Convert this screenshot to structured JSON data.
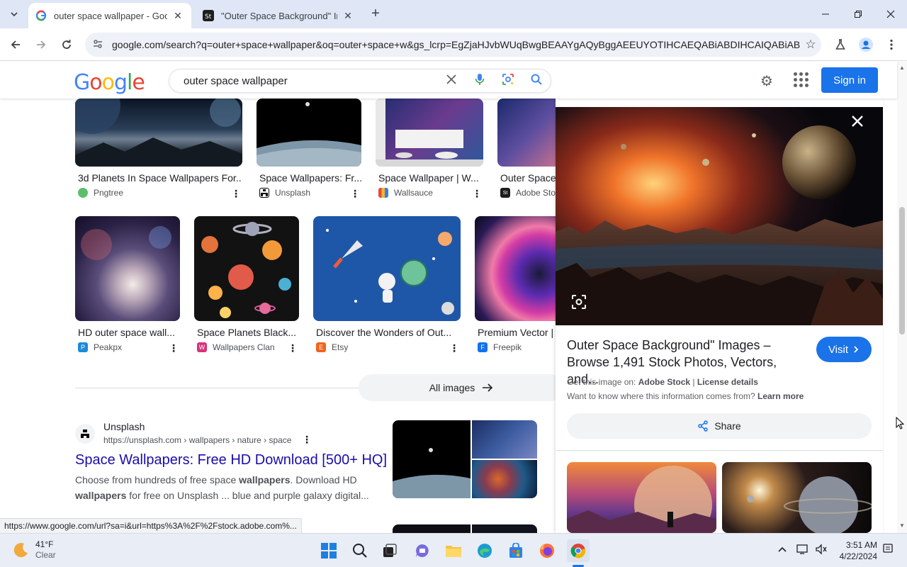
{
  "browser": {
    "tabs": [
      {
        "title": "outer space wallpaper - Google",
        "active": true
      },
      {
        "title": "\"Outer Space Background\" Im",
        "active": false
      }
    ],
    "url": "google.com/search?q=outer+space+wallpaper&oq=outer+space+w&gs_lcrp=EgZjaHJvbWUqBwgBEAAYgAQyBggAEEUYOTIHCAEQABiABDIHCAIQABiABD..."
  },
  "google": {
    "logo": "Google",
    "query": "outer space wallpaper",
    "signin": "Sign in"
  },
  "images_row1": [
    {
      "caption": "3d Planets In Space Wallpapers For...",
      "source": "Pngtree"
    },
    {
      "caption": "Space Wallpapers: Fr...",
      "source": "Unsplash"
    },
    {
      "caption": "Space Wallpaper | W...",
      "source": "Wallsauce"
    },
    {
      "caption": "Outer Space",
      "source": "Adobe Sto"
    }
  ],
  "images_row2": [
    {
      "caption": "HD outer space wall...",
      "source": "Peakpx"
    },
    {
      "caption": "Space Planets Black...",
      "source": "Wallpapers Clan"
    },
    {
      "caption": "Discover the Wonders of Out...",
      "source": "Etsy"
    },
    {
      "caption": "Premium Vector |",
      "source": "Freepik"
    }
  ],
  "all_images": "All images",
  "result": {
    "site": "Unsplash",
    "url": "https://unsplash.com › wallpapers › nature › space",
    "title": "Space Wallpapers: Free HD Download [500+ HQ]",
    "snippet_1a": "Choose from hundreds of free space ",
    "snippet_1b": "wallpapers",
    "snippet_1c": ". Download HD",
    "snippet_2a": "wallpapers",
    "snippet_2b": " for free on Unsplash ... blue and purple galaxy digital..."
  },
  "status_url": "https://www.google.com/url?sa=i&url=https%3A%2F%2Fstock.adobe.com%...",
  "panel": {
    "title": "Outer Space Background\" Images – Browse 1,491 Stock Photos, Vectors, and...",
    "visit": "Visit",
    "get_image_prefix": "Get this image on: ",
    "get_image_source": "Adobe Stock",
    "get_image_sep": " | ",
    "license": "License details",
    "want_prefix": "Want to know where this information comes from? ",
    "learn_more": "Learn more",
    "share": "Share"
  },
  "taskbar": {
    "temp": "41°F",
    "condition": "Clear",
    "time": "3:51 AM",
    "date": "4/22/2024"
  }
}
